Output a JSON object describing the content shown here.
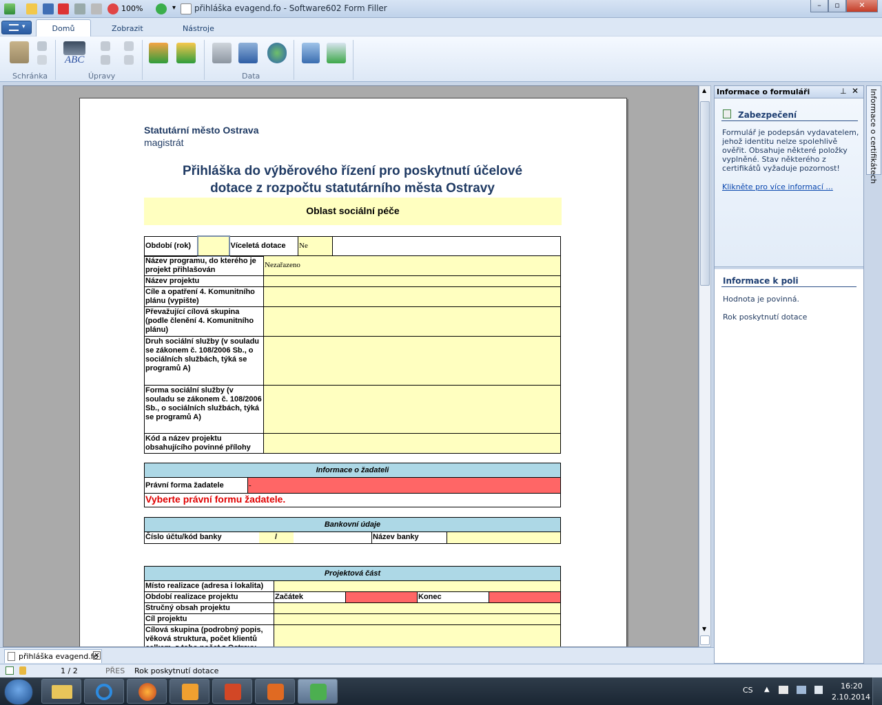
{
  "window": {
    "title": "přihláška evagend.fo - Software602 Form Filler",
    "zoom": "100%"
  },
  "ribbon": {
    "tabs": [
      "Domů",
      "Zobrazit",
      "Nástroje"
    ],
    "groups": [
      "Schránka",
      "Úpravy",
      "Data"
    ],
    "abc_label": "ABC"
  },
  "form": {
    "org_name": "Statutární město Ostrava",
    "org_sub": "magistrát",
    "heading_1": "Přihláška do výběrového řízení pro poskytnutí účelové",
    "heading_2": "dotace z rozpočtu statutárního města Ostravy",
    "area": "Oblast sociální péče",
    "general": {
      "period_label": "Období (rok)",
      "period_value": "",
      "multi_year_label": "Víceletá dotace",
      "multi_year_value": "Ne",
      "rows": [
        {
          "label": "Název programu, do kterého je projekt přihlašován",
          "value": "Nezařazeno"
        },
        {
          "label": "Název projektu",
          "value": ""
        },
        {
          "label": "Cíle a opatření 4. Komunitního plánu (vypište)",
          "value": ""
        },
        {
          "label": "Převažující cílová skupina (podle členění 4. Komunitního plánu)",
          "value": ""
        },
        {
          "label": "Druh sociální služby (v souladu se zákonem č. 108/2006 Sb., o sociálních službách, týká se programů A)",
          "value": ""
        },
        {
          "label": "Forma sociální služby (v souladu se zákonem č. 108/2006 Sb., o sociálních službách, týká se programů A)",
          "value": ""
        },
        {
          "label": "Kód a název projektu obsahujícího povinné přílohy",
          "value": ""
        }
      ]
    },
    "applicant": {
      "header": "Informace o žadateli",
      "legal_form_label": "Právní forma žadatele",
      "legal_form_value": "-",
      "error": "Vyberte právní formu žadatele."
    },
    "bank": {
      "header": "Bankovní údaje",
      "account_label": "Číslo účtu/kód banky",
      "account_sep": "/",
      "bank_name_label": "Název banky"
    },
    "project": {
      "header": "Projektová část",
      "place_label": "Místo realizace (adresa i lokalita)",
      "period_label": "Období realizace projektu",
      "start_label": "Začátek",
      "end_label": "Konec",
      "summary_label": "Stručný obsah projektu",
      "goal_label": "Cíl projektu",
      "target_label": "Cílová skupina (podrobný popis, věková struktura, počet klientů celkem, z toho počet z Ostravy"
    }
  },
  "side_panel": {
    "title": "Informace o formuláři",
    "vertical_tab": "Informace o certifikátech",
    "security_title": "Zabezpečení",
    "security_text": "Formulář je podepsán vydavatelem, jehož identitu nelze spolehlivě ověřit. Obsahuje některé položky vyplněné. Stav některého z certifikátů vyžaduje pozornost!",
    "security_link": "Klikněte pro více informací ...",
    "field_info_title": "Informace k poli",
    "field_required": "Hodnota je povinná.",
    "field_desc": "Rok poskytnutí dotace"
  },
  "doc_tab": {
    "label": "přihláška evagend.fo"
  },
  "status": {
    "page": "1 / 2",
    "mode": "PŘES",
    "field": "Rok poskytnutí dotace"
  },
  "taskbar": {
    "lang": "CS",
    "time": "16:20",
    "date": "2.10.2014"
  },
  "colors": {
    "required_yellow": "#ffffc0",
    "error_red": "#ff6666",
    "section_blue": "#add8e6",
    "heading_blue": "#1f3a63"
  }
}
